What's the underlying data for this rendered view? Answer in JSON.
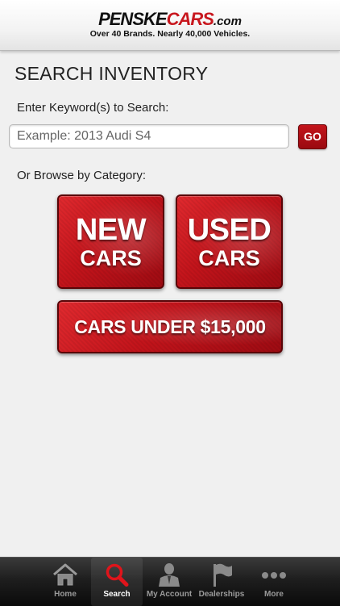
{
  "header": {
    "logo_part1": "PENSKE",
    "logo_part2": "CARS",
    "logo_part3": ".com",
    "tagline": "Over 40 Brands. Nearly 40,000 Vehicles."
  },
  "page": {
    "title": "SEARCH INVENTORY",
    "keyword_label": "Enter Keyword(s) to Search:",
    "search_placeholder": "Example: 2013 Audi S4",
    "search_value": "",
    "go_label": "GO",
    "browse_label": "Or Browse by Category:"
  },
  "categories": {
    "new": {
      "line1": "NEW",
      "line2": "CARS"
    },
    "used": {
      "line1": "USED",
      "line2": "CARS"
    },
    "under": {
      "label": "CARS UNDER $15,000"
    }
  },
  "tabbar": {
    "tabs": [
      {
        "label": "Home",
        "icon": "home-icon",
        "active": false
      },
      {
        "label": "Search",
        "icon": "search-icon",
        "active": true
      },
      {
        "label": "My Account",
        "icon": "account-icon",
        "active": false
      },
      {
        "label": "Dealerships",
        "icon": "flag-icon",
        "active": false
      },
      {
        "label": "More",
        "icon": "more-icon",
        "active": false
      }
    ]
  },
  "colors": {
    "brand_red": "#c3141b",
    "background": "#f0f0f0",
    "tabbar": "#1e1e1e"
  }
}
